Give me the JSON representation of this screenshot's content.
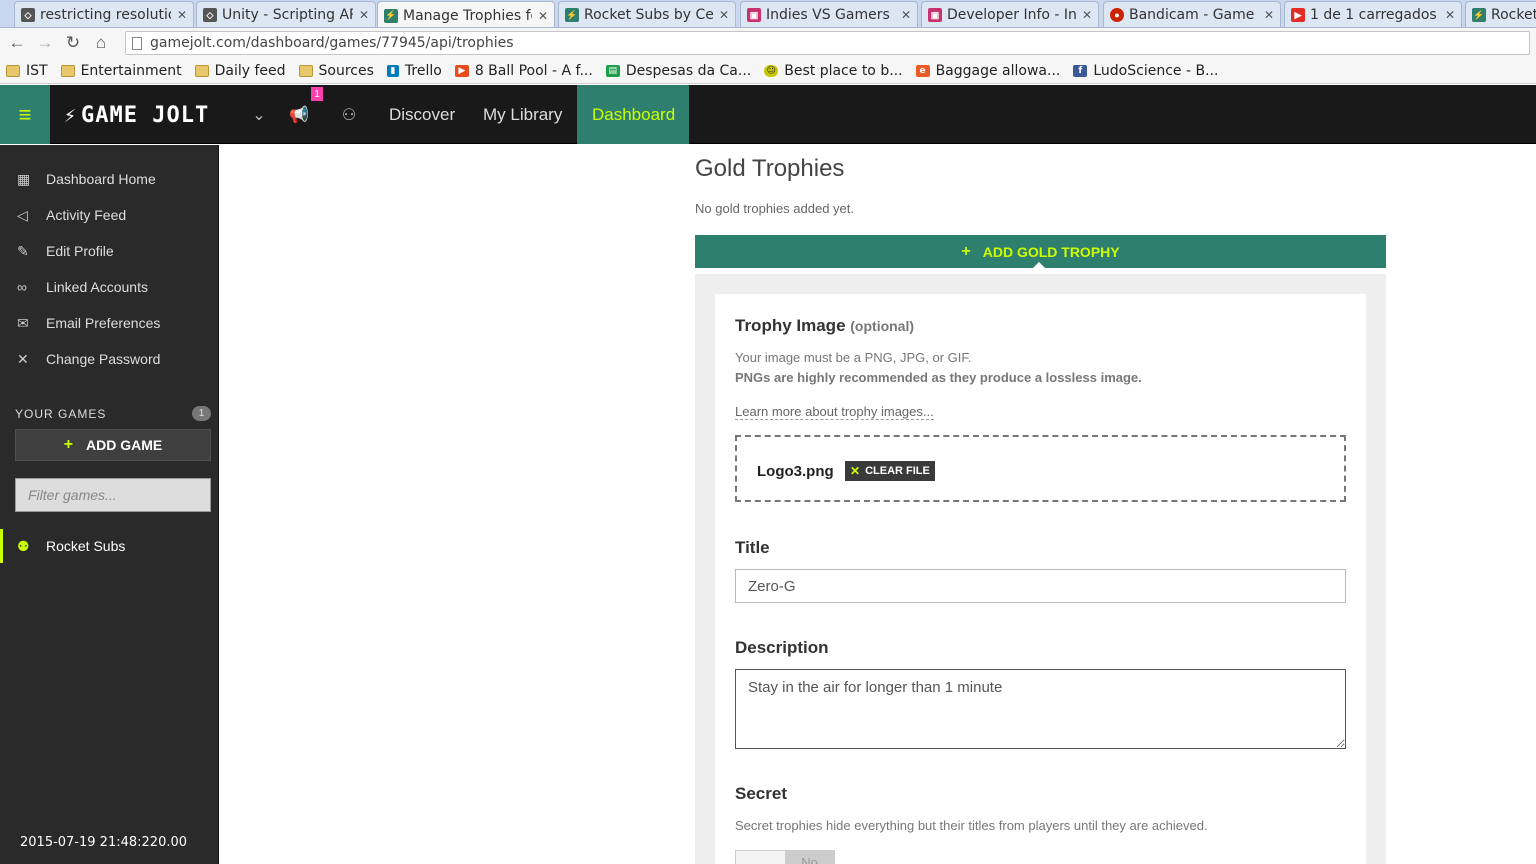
{
  "browser": {
    "tabs": [
      {
        "label": "restricting resolutio",
        "color": "#555555"
      },
      {
        "label": "Unity - Scripting AP",
        "color": "#555555"
      },
      {
        "label": "Manage Trophies fo",
        "color": "#2f7f6f"
      },
      {
        "label": "Rocket Subs by Cel",
        "color": "#2f7f6f"
      },
      {
        "label": "Indies VS Gamers |",
        "color": "#c8326e"
      },
      {
        "label": "Developer Info - In",
        "color": "#c8326e"
      },
      {
        "label": "Bandicam - Game R",
        "color": "#cc2200"
      },
      {
        "label": "1 de 1 carregados -",
        "color": "#e52d27"
      },
      {
        "label": "Rocket",
        "color": "#2f7f6f"
      }
    ],
    "url": "gamejolt.com/dashboard/games/77945/api/trophies",
    "bookmarks": [
      {
        "label": "IST",
        "icon": "folder-icon"
      },
      {
        "label": "Entertainment",
        "icon": "folder-icon"
      },
      {
        "label": "Daily feed",
        "icon": "folder-icon"
      },
      {
        "label": "Sources",
        "icon": "folder-icon"
      },
      {
        "label": "Trello",
        "icon": "trello-icon"
      },
      {
        "label": "8 Ball Pool - A f...",
        "icon": "play-icon"
      },
      {
        "label": "Despesas da Ca...",
        "icon": "sheet-icon"
      },
      {
        "label": "Best place to b...",
        "icon": "smiley-icon"
      },
      {
        "label": "Baggage allowa...",
        "icon": "e-icon"
      },
      {
        "label": "LudoScience - B...",
        "icon": "facebook-icon"
      }
    ]
  },
  "header": {
    "logo": "GAME JOLT",
    "notification_count": "1",
    "nav": [
      "Discover",
      "My Library",
      "Dashboard"
    ],
    "accent": "#ccff00",
    "brand": "#2f7f6f"
  },
  "sidebar": {
    "items": [
      {
        "label": "Dashboard Home",
        "icon": "dashboard-icon"
      },
      {
        "label": "Activity Feed",
        "icon": "megaphone-icon"
      },
      {
        "label": "Edit Profile",
        "icon": "pencil-icon"
      },
      {
        "label": "Linked Accounts",
        "icon": "link-icon"
      },
      {
        "label": "Email Preferences",
        "icon": "envelope-icon"
      },
      {
        "label": "Change Password",
        "icon": "tools-icon"
      }
    ],
    "games_heading": "YOUR GAMES",
    "games_count": "1",
    "add_game": "ADD GAME",
    "filter_placeholder": "Filter games...",
    "game": "Rocket Subs"
  },
  "overlay_timestamp": "2015-07-19 21:48:220.00",
  "main": {
    "section_title": "Gold Trophies",
    "section_note": "No gold trophies added yet.",
    "add_button": "ADD GOLD TROPHY",
    "form": {
      "image_label": "Trophy Image",
      "image_optional": "(optional)",
      "image_help_1": "Your image must be a PNG, JPG, or GIF.",
      "image_help_2": "PNGs are highly recommended as they produce a lossless image.",
      "image_link": "Learn more about trophy images...",
      "file_name": "Logo3.png",
      "clear_file": "CLEAR FILE",
      "title_label": "Title",
      "title_value": "Zero-G",
      "description_label": "Description",
      "description_value": "Stay in the air for longer than 1 minute",
      "secret_label": "Secret",
      "secret_help": "Secret trophies hide everything but their titles from players until they are achieved.",
      "secret_toggle_off": "No"
    }
  }
}
